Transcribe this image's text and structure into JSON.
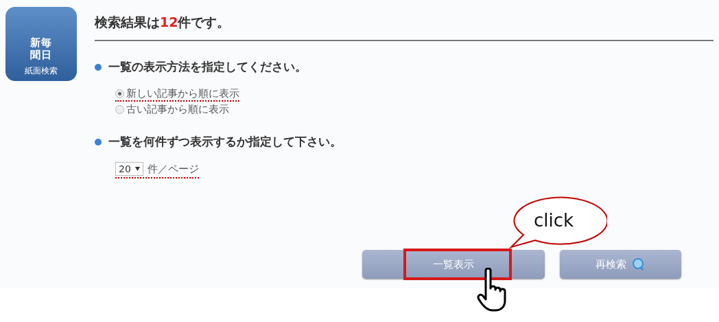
{
  "app_icon": {
    "lines": [
      "新毎",
      "聞日",
      "紙面検索"
    ]
  },
  "result": {
    "before": "検索結果は",
    "count": "12",
    "after": "件です。"
  },
  "sort_section": {
    "heading": "一覧の表示方法を指定してください。",
    "options": [
      {
        "label": "新しい記事から順に表示",
        "selected": true
      },
      {
        "label": "古い記事から順に表示",
        "selected": false
      }
    ]
  },
  "page_size_section": {
    "heading": "一覧を何件ずつ表示するか指定して下さい。",
    "select_value": "20",
    "unit": "件／ページ"
  },
  "buttons": [
    {
      "label": "一覧表示",
      "kind": "list",
      "highlighted": true
    },
    {
      "label": "再検索",
      "kind": "search",
      "highlighted": false
    }
  ],
  "callout": {
    "text": "click"
  }
}
